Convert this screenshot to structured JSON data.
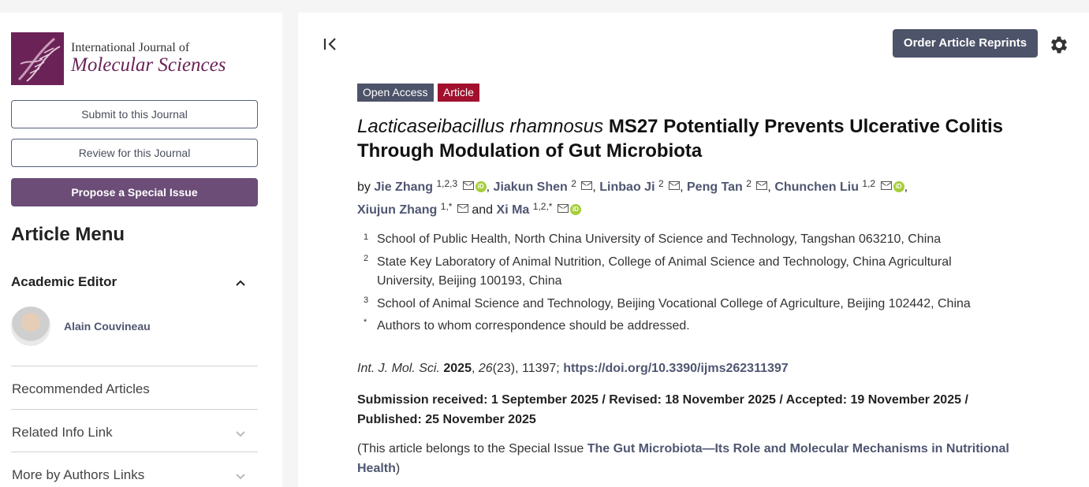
{
  "sidebar": {
    "journal_line1": "International Journal of",
    "journal_line2": "Molecular Sciences",
    "submit_label": "Submit to this Journal",
    "review_label": "Review for this Journal",
    "propose_label": "Propose a Special Issue",
    "menu_title": "Article Menu",
    "editor_heading": "Academic Editor",
    "editor_name": "Alain Couvineau",
    "links": [
      "Recommended Articles",
      "Related Info Link",
      "More by Authors Links"
    ]
  },
  "header": {
    "reprints_label": "Order Article Reprints"
  },
  "article": {
    "badge_open_access": "Open Access",
    "badge_type": "Article",
    "title_italic": "Lacticaseibacillus rhamnosus",
    "title_rest": " MS27 Potentially Prevents Ulcerative Colitis Through Modulation of Gut Microbiota",
    "by": "by",
    "and": "and",
    "authors": [
      {
        "name": "Jie Zhang",
        "sup": "1,2,3",
        "orcid": true
      },
      {
        "name": "Jiakun Shen",
        "sup": "2",
        "orcid": false
      },
      {
        "name": "Linbao Ji",
        "sup": "2",
        "orcid": false
      },
      {
        "name": "Peng Tan",
        "sup": "2",
        "orcid": false
      },
      {
        "name": "Chunchen Liu",
        "sup": "1,2",
        "orcid": true
      },
      {
        "name": "Xiujun Zhang",
        "sup": "1,*",
        "orcid": false
      },
      {
        "name": "Xi Ma",
        "sup": "1,2,*",
        "orcid": true
      }
    ],
    "orcid_label": "iD",
    "affiliations": [
      {
        "num": "1",
        "text": "School of Public Health, North China University of Science and Technology, Tangshan 063210, China"
      },
      {
        "num": "2",
        "text": "State Key Laboratory of Animal Nutrition, College of Animal Science and Technology, China Agricultural University, Beijing 100193, China"
      },
      {
        "num": "3",
        "text": "School of Animal Science and Technology, Beijing Vocational College of Agriculture, Beijing 102442, China"
      },
      {
        "num": "*",
        "text": "Authors to whom correspondence should be addressed."
      }
    ],
    "citation_journal": "Int. J. Mol. Sci.",
    "citation_year": "2025",
    "citation_volume": "26",
    "citation_issue": "(23), 11397; ",
    "doi": "https://doi.org/10.3390/ijms262311397",
    "dates": "Submission received: 1 September 2025 / Revised: 18 November 2025 / Accepted: 19 November 2025 / Published: 25 November 2025",
    "special_prefix": "(This article belongs to the Special Issue ",
    "special_issue": "The Gut Microbiota—Its Role and Molecular Mechanisms in Nutritional Health",
    "special_suffix": ")"
  },
  "colors": {
    "brand": "#6b2357",
    "button_dark": "#4d5369",
    "article_red": "#a1112d",
    "link": "#4f5671",
    "orcid": "#a6ce39"
  }
}
